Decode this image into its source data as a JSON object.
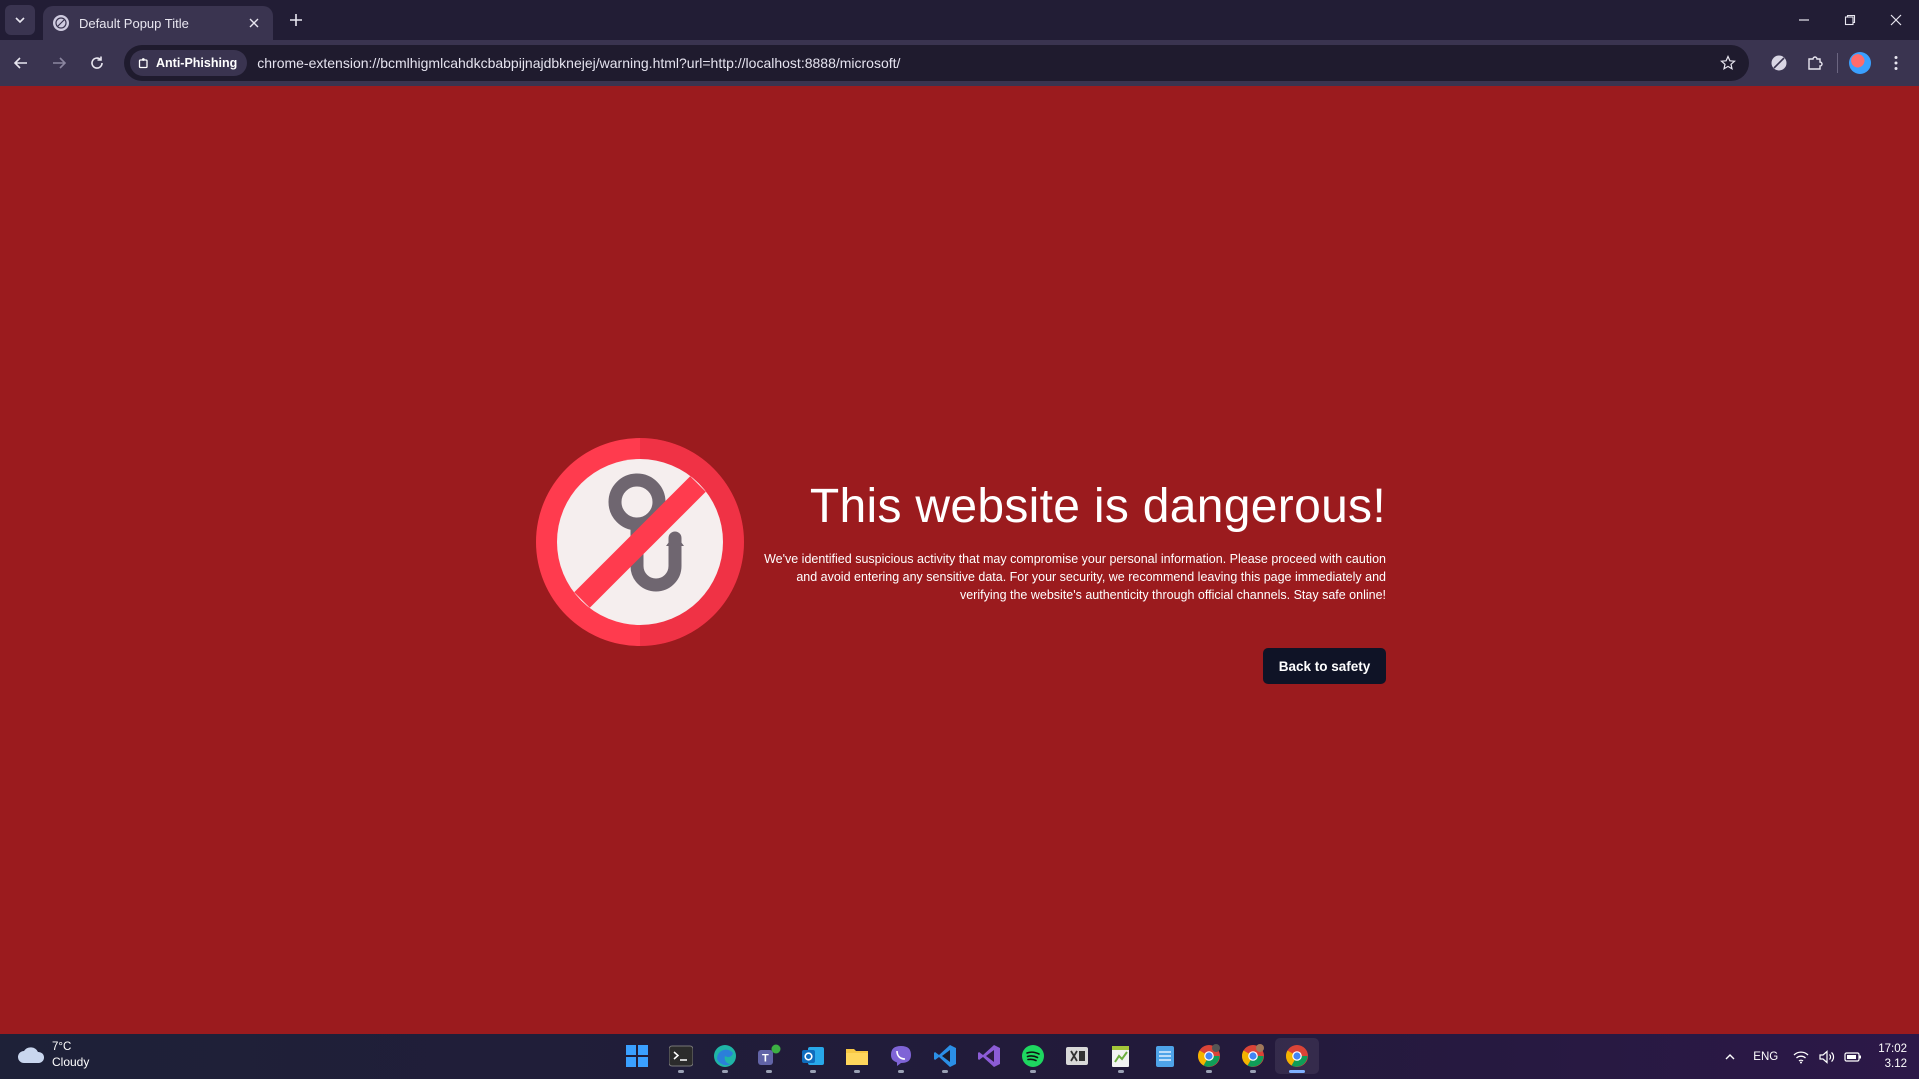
{
  "browser": {
    "tab_title": "Default Popup Title",
    "security_chip": "Anti-Phishing",
    "url": "chrome-extension://bcmlhigmlcahdkcbabpijnajdbknejej/warning.html?url=http://localhost:8888/microsoft/"
  },
  "warning": {
    "title": "This website is dangerous!",
    "body": "We've identified suspicious activity that may compromise your personal information. Please proceed with caution and avoid entering any sensitive data. For your security, we recommend leaving this page immediately and verifying the website's authenticity through official channels. Stay safe online!",
    "button_label": "Back to safety"
  },
  "taskbar": {
    "weather_temp": "7°C",
    "weather_desc": "Cloudy",
    "language": "ENG",
    "time": "17:02",
    "date": "3.12",
    "apps": [
      {
        "name": "start-icon",
        "color": "#3aa0ff"
      },
      {
        "name": "terminal-icon",
        "color": "#2b2b2b"
      },
      {
        "name": "edge-icon",
        "color": "#1fb5a6"
      },
      {
        "name": "teams-icon",
        "color": "#6264a7"
      },
      {
        "name": "outlook-icon",
        "color": "#0f6cbd"
      },
      {
        "name": "file-explorer-icon",
        "color": "#f7c744"
      },
      {
        "name": "viber-icon",
        "color": "#7f64d6"
      },
      {
        "name": "vscode-icon",
        "color": "#2b8fe6"
      },
      {
        "name": "visual-studio-icon",
        "color": "#8c5cd6"
      },
      {
        "name": "spotify-icon",
        "color": "#1ed760"
      },
      {
        "name": "excel-tool-icon",
        "color": "#d9d9d9"
      },
      {
        "name": "notepadpp-icon",
        "color": "#a4c639"
      },
      {
        "name": "notepad-icon",
        "color": "#4ea3e8"
      },
      {
        "name": "chrome-profile-1-icon",
        "color": "#e9a23b"
      },
      {
        "name": "chrome-profile-2-icon",
        "color": "#e9a23b"
      },
      {
        "name": "chrome-active-icon",
        "color": "#e9a23b"
      }
    ]
  },
  "colors": {
    "page_background": "#9b1b1e",
    "button_background": "#0f1326",
    "icon_red": "#ff3b4e"
  }
}
